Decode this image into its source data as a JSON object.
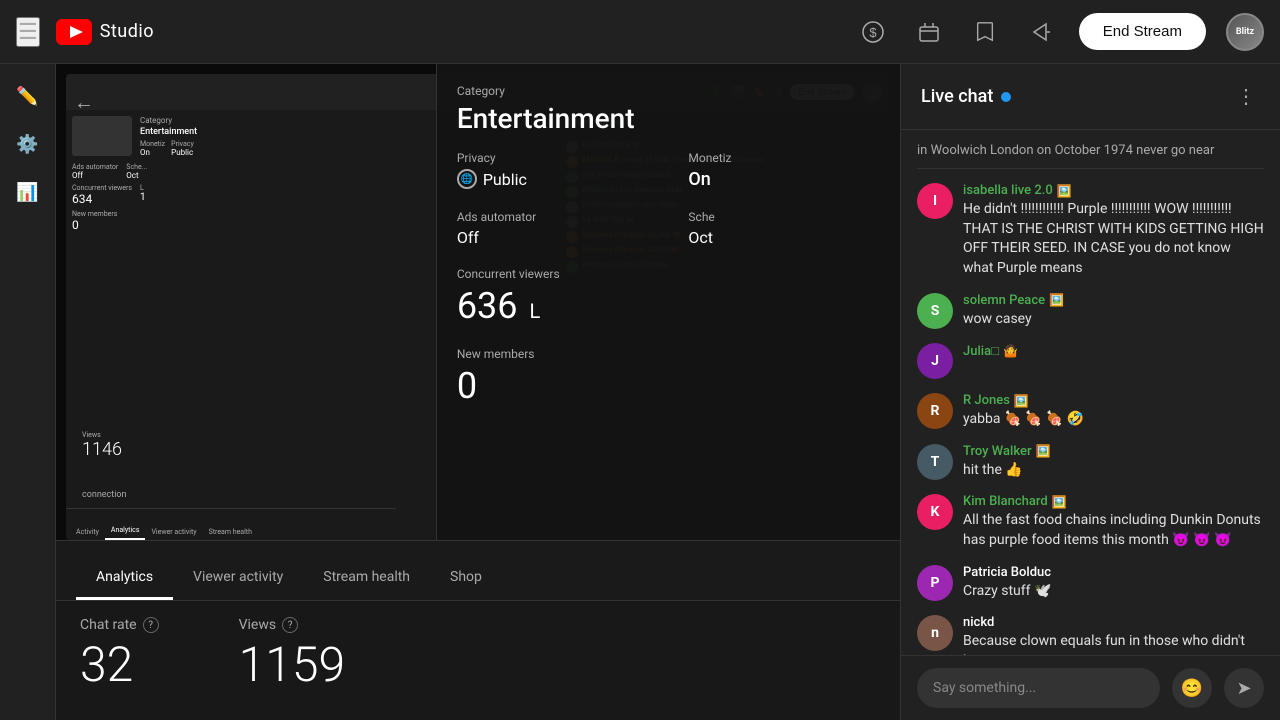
{
  "app": {
    "title": "YouTube Studio",
    "logo_text": "Studio"
  },
  "header": {
    "end_stream_label": "End Stream",
    "avatar_text": "Blitz",
    "hamburger_label": "☰"
  },
  "nav_icons": {
    "monetize": "💲",
    "clips": "🎬",
    "save": "🔖",
    "share": "↗"
  },
  "sidebar": {
    "items": [
      {
        "icon": "✏️",
        "name": "edit"
      },
      {
        "icon": "⚙️",
        "name": "settings"
      },
      {
        "icon": "📊",
        "name": "dashboard"
      }
    ]
  },
  "stream_settings": {
    "category_label": "Category",
    "category_value": "Entertainment",
    "privacy_label": "Privacy",
    "privacy_value": "Public",
    "monetize_label": "Monetiz",
    "monetize_value": "On",
    "ads_label": "Ads automator",
    "ads_value": "Off",
    "schedule_label": "Sche",
    "schedule_value": "Oct",
    "concurrent_label": "Concurrent viewers",
    "concurrent_value": "636",
    "live_label": "L",
    "new_members_label": "New members",
    "new_members_value": "0",
    "views_label": "Views",
    "views_value": "1146"
  },
  "nested_preview": {
    "chat_title": "Live chat",
    "messages": [
      {
        "name": "La Rain Ray",
        "text": "why?",
        "color": "#aaa"
      },
      {
        "name": "MAGGIE B",
        "text": "I made $3.50 in 73 working in hospital kitchen",
        "color": "#FF9800"
      },
      {
        "name": "Joe Potter",
        "text": "sloppy seconds",
        "color": "#aaa"
      },
      {
        "name": "Rebecca Lynn",
        "text": "blessings @DM",
        "color": "#4CAF50"
      },
      {
        "name": "Littlewingbwas9",
        "text": "why Yabba",
        "color": "#aaa"
      },
      {
        "name": "La Rain Ray",
        "text": "lol",
        "color": "#aaa"
      },
      {
        "name": "Bonnie LeStrange",
        "text": "IELENE ❤️ ✓",
        "color": "#FF9800"
      },
      {
        "name": "Bonnie LeStrange",
        "text": "DAWN ❤️ ✓",
        "color": "#FF9800"
      },
      {
        "name": "Rebecca Lynn",
        "text": "lol @Yabba...",
        "color": "#4CAF50"
      }
    ]
  },
  "tabs": [
    {
      "label": "Analytics",
      "active": true
    },
    {
      "label": "Viewer activity",
      "active": false
    },
    {
      "label": "Stream health",
      "active": false
    },
    {
      "label": "Shop",
      "active": false
    }
  ],
  "analytics": {
    "chat_rate_label": "Chat rate",
    "chat_rate_value": "32",
    "views_label": "Views",
    "views_value": "1159"
  },
  "live_chat": {
    "title": "Live chat",
    "more_label": "⋮",
    "messages": [
      {
        "id": "msg-isabella",
        "avatar_color": "#E91E63",
        "avatar_text": "I",
        "name": "isabella live 2.0",
        "name_color": "#4CAF50",
        "name_emoji": "🖼️",
        "text": "He didn't !!!!!!!!!!!! Purple !!!!!!!!!!! WOW !!!!!!!!!!! THAT IS THE CHRIST WITH KIDS GETTING HIGH OFF THEIR SEED. IN CASE you do not know what Purple means"
      },
      {
        "id": "msg-solemn",
        "avatar_color": "#4CAF50",
        "avatar_text": "S",
        "name": "solemn Peace",
        "name_color": "#4CAF50",
        "name_emoji": "🖼️",
        "text": "wow casey"
      },
      {
        "id": "msg-julia",
        "avatar_color": "#7B1FA2",
        "avatar_text": "J",
        "name": "Julia□",
        "name_color": "#4CAF50",
        "name_emoji": "🤷",
        "text": ""
      },
      {
        "id": "msg-jones",
        "avatar_color": "#8B4513",
        "avatar_text": "R",
        "name": "R Jones",
        "name_color": "#4CAF50",
        "name_emoji": "🖼️",
        "text": "yabba 🍖 🍖 🍖 🤣"
      },
      {
        "id": "msg-troy",
        "avatar_color": "#555",
        "avatar_text": "T",
        "name": "Troy Walker",
        "name_color": "#4CAF50",
        "name_emoji": "🖼️",
        "text": "hit the 👍"
      },
      {
        "id": "msg-kim",
        "avatar_color": "#E91E63",
        "avatar_text": "K",
        "name": "Kim Blanchard",
        "name_color": "#4CAF50",
        "name_emoji": "🖼️",
        "text": "All the fast food chains including Dunkin Donuts has purple food items this month 😈 😈 😈"
      },
      {
        "id": "msg-patricia",
        "avatar_color": "#9C27B0",
        "avatar_text": "P",
        "name": "Patricia Bolduc",
        "name_color": "#fff",
        "text": "Crazy stuff 🕊️"
      },
      {
        "id": "msg-nickd",
        "avatar_color": "#795548",
        "avatar_text": "n",
        "name": "nickd",
        "name_color": "#fff",
        "text": "Because clown equals fun in those who didn't know"
      }
    ]
  },
  "connection": {
    "label": "connection"
  }
}
